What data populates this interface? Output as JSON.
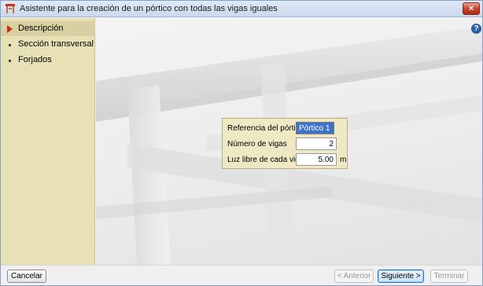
{
  "window": {
    "title": "Asistente para la creación de un pórtico con todas las vigas iguales",
    "close_label": "×",
    "help_label": "?"
  },
  "sidebar": {
    "items": [
      {
        "label": "Descripción",
        "active": true
      },
      {
        "label": "Sección transversal",
        "active": false
      },
      {
        "label": "Forjados",
        "active": false
      }
    ]
  },
  "form": {
    "referencia_label": "Referencia del pórtico",
    "referencia_value": "Pórtico 1",
    "num_vigas_label": "Número de vigas",
    "num_vigas_value": "2",
    "luz_label": "Luz libre de cada viga",
    "luz_value": "5.00",
    "luz_unit": "m"
  },
  "footer": {
    "cancel_label": "Cancelar",
    "back_label": "< Anterior",
    "next_label": "Siguiente >",
    "finish_label": "Terminar"
  },
  "colors": {
    "sidebar_bg": "#e7e1b5",
    "panel_bg": "#efe8c4",
    "selection": "#3f73c9",
    "active_arrow": "#cc2a1a"
  }
}
